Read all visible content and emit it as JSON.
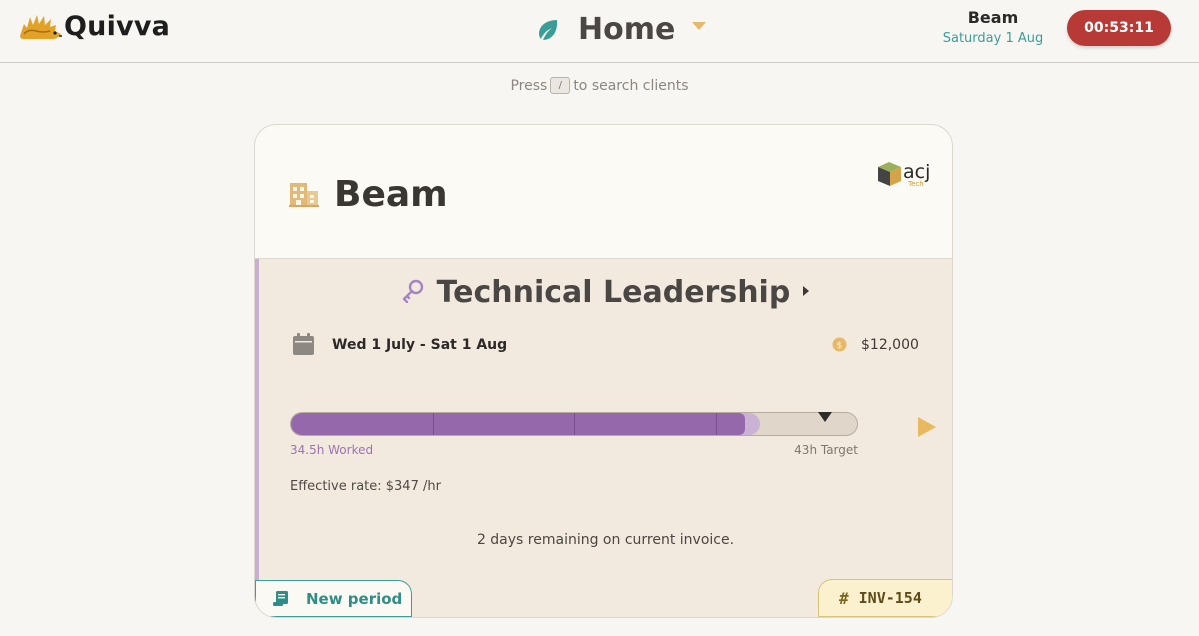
{
  "app": {
    "name": "Quivva"
  },
  "header": {
    "page_title": "Home",
    "user_name": "Beam",
    "date": "Saturday 1 Aug",
    "timer": "00:53:11"
  },
  "search": {
    "prefix": "Press",
    "key": "/",
    "suffix": "to search clients"
  },
  "client": {
    "name": "Beam",
    "logo_text": "acj",
    "logo_subtext": "Tech",
    "project": {
      "name": "Technical Leadership",
      "period": "Wed 1 July - Sat 1 Aug",
      "amount": "$12,000",
      "worked_label": "34.5h Worked",
      "target_label": "43h Target",
      "worked_hours": 34.5,
      "target_hours": 43,
      "effective_rate": "Effective rate: $347 /hr",
      "remaining": "2 days remaining on current invoice.",
      "new_period_label": "New period",
      "invoice_hash": "#",
      "invoice_number": "INV-154"
    }
  },
  "colors": {
    "accent_teal": "#3a9e97",
    "timer_red": "#b73a36",
    "progress_purple": "#9567ab",
    "invoice_gold": "#fbf1cf"
  },
  "icons": [
    "hedgehog-logo-icon",
    "leaf-icon",
    "caret-down-icon",
    "building-icon",
    "key-icon",
    "chevron-right-icon",
    "calendar-icon",
    "coin-icon",
    "play-icon",
    "scroll-icon"
  ]
}
